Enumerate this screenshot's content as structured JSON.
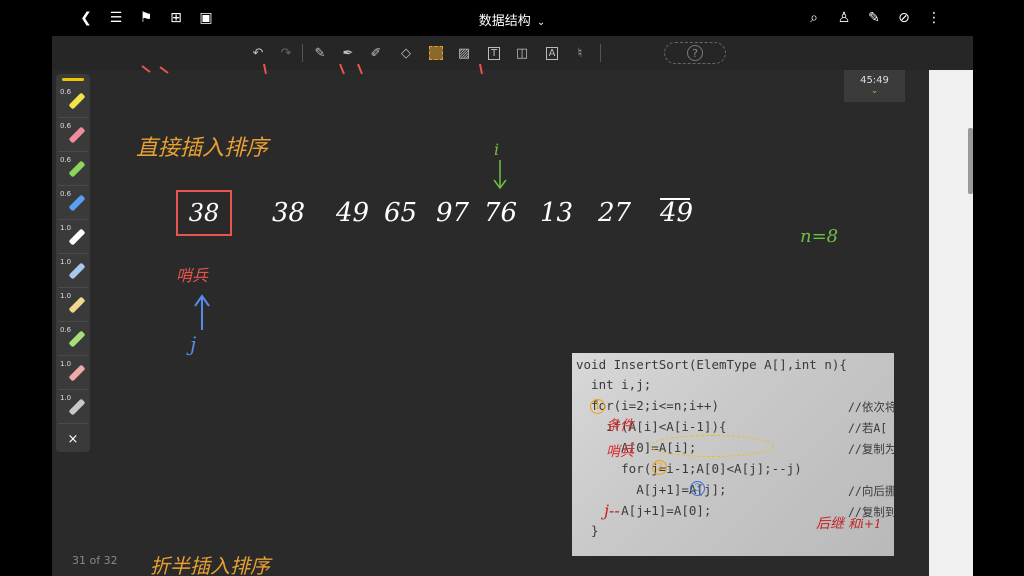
{
  "toolbar_top": {
    "title": "数据结构",
    "left_icons": [
      "back-icon",
      "outline-icon",
      "bookmark-icon",
      "add-page-icon",
      "crop-icon"
    ],
    "right_icons": [
      "search-icon",
      "shirt-icon",
      "pen-icon",
      "hide-icon",
      "more-icon"
    ]
  },
  "tools": [
    "undo-icon",
    "redo-icon",
    "pencil-icon",
    "pen-icon",
    "highlighter-icon",
    "eraser-icon",
    "lasso-icon",
    "image-icon",
    "text-icon",
    "shape-icon",
    "ocr-icon",
    "mic-icon"
  ],
  "colors": {
    "orange": "#e8a033",
    "red": "#e8544e",
    "green": "#6fbf45",
    "blue": "#5a8ae8",
    "yellow_pen": "#f0c400"
  },
  "palette": {
    "pens": [
      {
        "width": "0.6",
        "color": "#f2e44a"
      },
      {
        "width": "0.6",
        "color": "#f08ca0"
      },
      {
        "width": "0.6",
        "color": "#8cd65a"
      },
      {
        "width": "0.6",
        "color": "#5aa0f0"
      },
      {
        "width": "1.0",
        "color": "#ffffff"
      },
      {
        "width": "1.0",
        "color": "#a8c8f0"
      },
      {
        "width": "1.0",
        "color": "#f0d890"
      },
      {
        "width": "0.6",
        "color": "#a8e078"
      },
      {
        "width": "1.0",
        "color": "#f0a8a8"
      },
      {
        "width": "1.0",
        "color": "#c8c8c8"
      }
    ],
    "close": "×"
  },
  "timer": "45:49",
  "page_indicator": "31 of 32",
  "notes": {
    "title1": "直接插入排序",
    "title2": "折半插入排序",
    "sentinel_value": "38",
    "sequence": [
      "38",
      "49",
      "65",
      "97",
      "76",
      "13",
      "27",
      "49"
    ],
    "n_label": "n=8",
    "sentinel_label": "哨兵",
    "j_label": "j",
    "i_label": "i"
  },
  "code_photo": {
    "lines": [
      "void InsertSort(ElemType A[],int n){",
      "  int i,j;",
      "  for(i=2;i<=n;i++)",
      "    if(A[i]<A[i-1]){",
      "      A[0]=A[i];",
      "      for(j=i-1;A[0]<A[j];--j)",
      "        A[j+1]=A[j];",
      "      A[j+1]=A[0];",
      "  }"
    ],
    "comments": [
      "",
      "",
      "//依次将",
      "//若A[",
      "//复制为",
      "",
      "//向后挪",
      "//复制到",
      ""
    ],
    "annotations": {
      "one": "1",
      "two": "2",
      "three": "3",
      "cond": "条件",
      "sentinel": "哨兵",
      "j_note": "j--",
      "after": "后继",
      "after2": "和i+1"
    }
  }
}
